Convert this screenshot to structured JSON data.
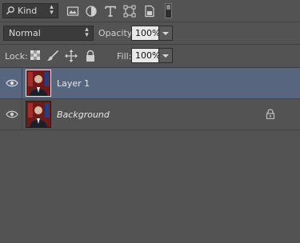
{
  "filter": {
    "kind_label": "Kind",
    "icons": [
      "image-filter-icon",
      "adjustment-filter-icon",
      "type-filter-icon",
      "shape-filter-icon",
      "smart-object-filter-icon",
      "filter-toggle-icon"
    ]
  },
  "blend": {
    "mode": "Normal",
    "opacity_label": "Opacity:",
    "opacity_value": "100%"
  },
  "lock": {
    "label": "Lock:",
    "icons": [
      "lock-transparent-icon",
      "lock-image-icon",
      "lock-position-icon",
      "lock-all-icon"
    ],
    "fill_label": "Fill:",
    "fill_value": "100%"
  },
  "layers": [
    {
      "name": "Layer 1",
      "selected": true,
      "visible": true,
      "locked": false
    },
    {
      "name": "Background",
      "selected": false,
      "visible": true,
      "locked": true
    }
  ],
  "colors": {
    "panel": "#535353",
    "selection": "#57667e",
    "field": "#3b3b3b"
  }
}
